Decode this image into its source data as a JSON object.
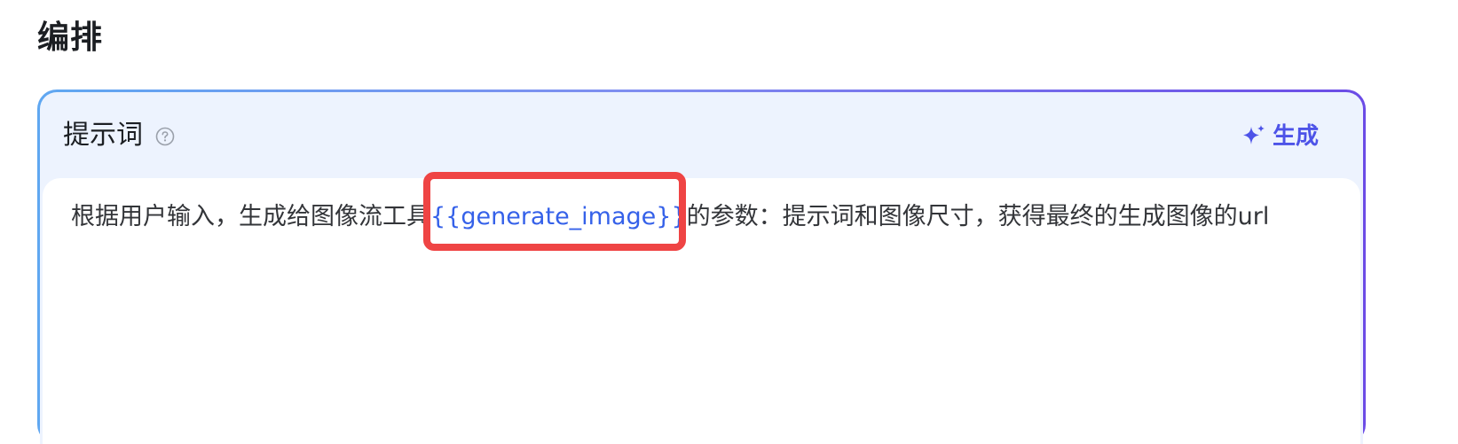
{
  "section": {
    "title": "编排"
  },
  "prompt_card": {
    "title": "提示词",
    "help_icon": "question-circle-icon",
    "generate_button": {
      "icon": "sparkle-icon",
      "label": "生成"
    },
    "editor": {
      "text_before": "根据用户输入，生成给图像流工具",
      "variable": "{{generate_image}}",
      "text_after": "的参数：提示词和图像尺寸，获得最终的生成图像的url"
    }
  },
  "colors": {
    "accent": "#4d53e8",
    "variable": "#3561e9",
    "highlight": "#ef4444",
    "header_bg": "#edf3fe",
    "border_gradient_start": "#5fa7f1",
    "border_gradient_end": "#6b4be6"
  }
}
